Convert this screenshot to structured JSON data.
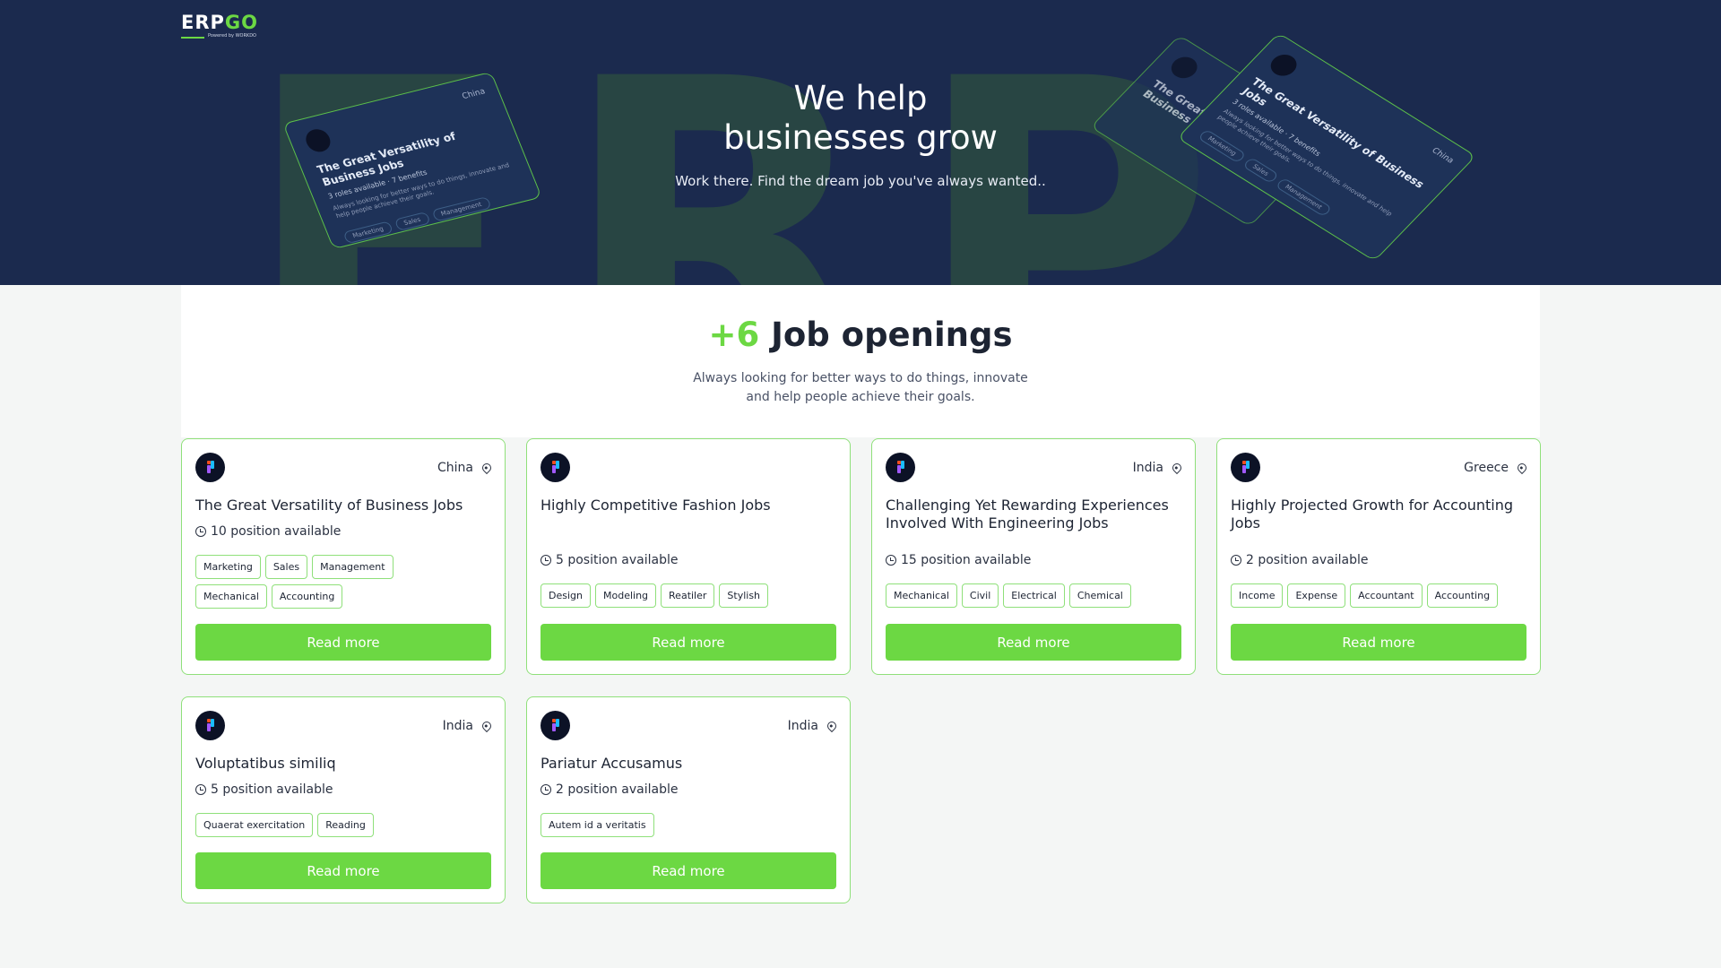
{
  "hero": {
    "background_letters": "ERP",
    "brand": {
      "name_part1": "ERP",
      "name_part2": "GO",
      "powered_by": "Powered by WORKDO"
    },
    "title_line1": "We help",
    "title_line2": "businesses grow",
    "subtitle": "Work there. Find the dream job you've always wanted..",
    "mock_cards": [
      {
        "location": "China",
        "title": "The Great Versatility of Business Jobs",
        "roles": "3 roles available",
        "benefits": "7 benefits",
        "desc": "Always looking for better ways to do things, innovate and help people achieve their goals.",
        "tags": [
          "Marketing",
          "Sales",
          "Management"
        ]
      },
      {
        "location": "China",
        "title": "The Great Versatility of Business Jobs",
        "roles": "3 roles available",
        "benefits": "7 benefits",
        "desc": "Always looking for better ways to do things, innovate and help people achieve their goals.",
        "tags": [
          "Marketing",
          "Sales",
          "Management"
        ]
      }
    ]
  },
  "openings": {
    "count": "+6",
    "title": "Job openings",
    "subtitle_line1": "Always looking for better ways to do things, innovate",
    "subtitle_line2": "and help people achieve their goals."
  },
  "jobs": [
    {
      "location": "China",
      "title": "The Great Versatility of Business Jobs",
      "positions": "10 position available",
      "tags": [
        "Marketing",
        "Sales",
        "Management",
        "Mechanical",
        "Accounting"
      ],
      "button": "Read more"
    },
    {
      "location": "",
      "title": "Highly Competitive Fashion Jobs",
      "positions": "5 position available",
      "tags": [
        "Design",
        "Modeling",
        "Reatiler",
        "Stylish"
      ],
      "button": "Read more"
    },
    {
      "location": "India",
      "title": "Challenging Yet Rewarding Experiences Involved With Engineering Jobs",
      "positions": "15 position available",
      "tags": [
        "Mechanical",
        "Civil",
        "Electrical",
        "Chemical"
      ],
      "button": "Read more"
    },
    {
      "location": "Greece",
      "title": "Highly Projected Growth for Accounting Jobs",
      "positions": "2 position available",
      "tags": [
        "Income",
        "Expense",
        "Accountant",
        "Accounting"
      ],
      "button": "Read more"
    },
    {
      "location": "India",
      "title": "Voluptatibus similiq",
      "positions": "5 position available",
      "tags": [
        "Quaerat exercitation",
        "Reading"
      ],
      "button": "Read more"
    },
    {
      "location": "India",
      "title": "Pariatur Accusamus",
      "positions": "2 position available",
      "tags": [
        "Autem id a veritatis"
      ],
      "button": "Read more"
    }
  ],
  "colors": {
    "hero_bg": "#1b2a4e",
    "accent": "#6cd843",
    "card_border": "#8fe07a"
  }
}
